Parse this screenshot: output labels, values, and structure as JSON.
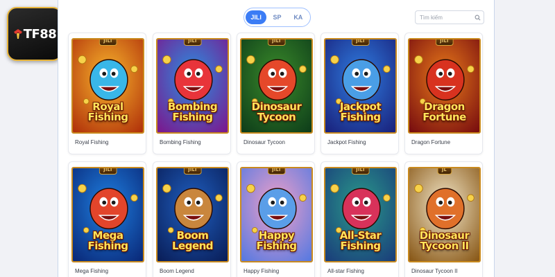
{
  "brand": {
    "logo_text": "TF88"
  },
  "provider_tabs": [
    {
      "label": "JILI",
      "active": true
    },
    {
      "label": "SP",
      "active": false
    },
    {
      "label": "KA",
      "active": false
    }
  ],
  "search": {
    "placeholder": "Tìm kiếm",
    "icon": "search-icon"
  },
  "games": [
    {
      "name": "Royal Fishing",
      "art_title": "Royal Fishing",
      "badge": "JILI",
      "bg": [
        "#f7b42c",
        "#b2340b"
      ],
      "creature": "#39b7e8"
    },
    {
      "name": "Bombing Fishing",
      "art_title": "Bombing Fishing",
      "badge": "JILI",
      "bg": [
        "#2a8fe0",
        "#7a1a8f"
      ],
      "creature": "#e8343a"
    },
    {
      "name": "Dinosaur Tycoon",
      "art_title": "Dinosaur Tycoon",
      "badge": "JILI",
      "bg": [
        "#3a8a2a",
        "#0f3f1a"
      ],
      "creature": "#e5482a"
    },
    {
      "name": "Jackpot Fishing",
      "art_title": "Jackpot Fishing",
      "badge": "JILI",
      "bg": [
        "#2f7de0",
        "#1a237e"
      ],
      "creature": "#4a9ee6"
    },
    {
      "name": "Dragon Fortune",
      "art_title": "Dragon Fortune",
      "badge": "JILI",
      "bg": [
        "#e87a1a",
        "#7a0f0f"
      ],
      "creature": "#d8321f"
    },
    {
      "name": "Mega Fishing",
      "art_title": "Mega Fishing",
      "badge": "JILI",
      "bg": [
        "#1f7fe0",
        "#0a2a7a"
      ],
      "creature": "#e2452b"
    },
    {
      "name": "Boom Legend",
      "art_title": "Boom Legend",
      "badge": "JILI",
      "bg": [
        "#1f5fc0",
        "#0a1f5a"
      ],
      "creature": "#c9863d"
    },
    {
      "name": "Happy Fishing",
      "art_title": "Happy Fishing",
      "badge": "JILI",
      "bg": [
        "#f0a0c8",
        "#5a7ae0"
      ],
      "creature": "#5a9ee8"
    },
    {
      "name": "All-star Fishing",
      "art_title": "All-Star Fishing",
      "badge": "JILI",
      "bg": [
        "#2a9a8a",
        "#1a3f7a"
      ],
      "creature": "#d8325a"
    },
    {
      "name": "Dinosaur Tycoon II",
      "art_title": "Dinosaur Tycoon II",
      "badge": "JL",
      "bg": [
        "#f2e6c8",
        "#8a5a1a"
      ],
      "creature": "#e0702a"
    }
  ]
}
